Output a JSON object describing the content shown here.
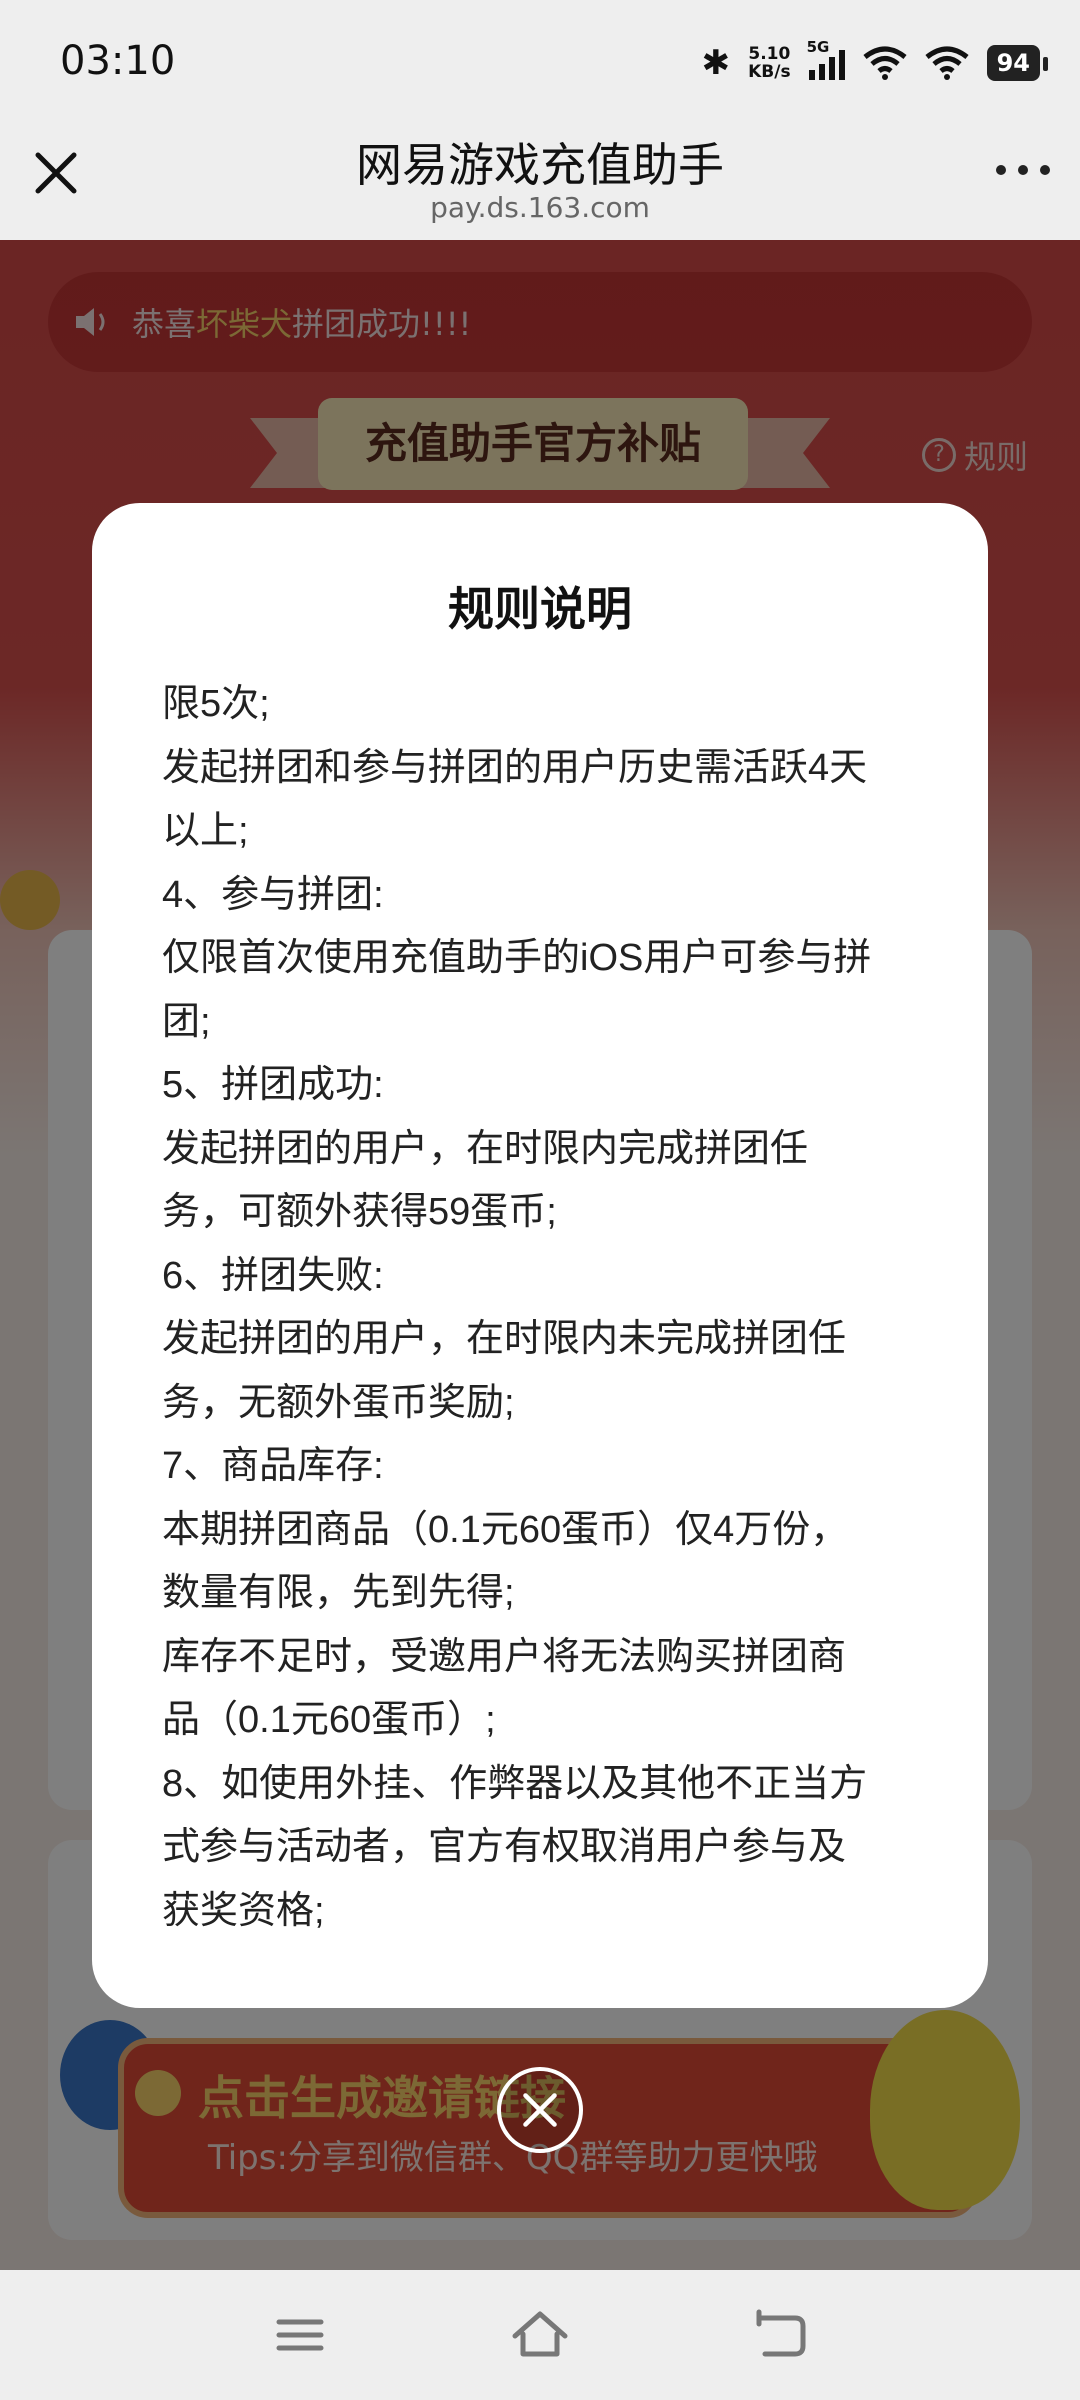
{
  "status_bar": {
    "time": "03:10",
    "speed_value": "5.10",
    "speed_unit": "KB/s",
    "network": "5G",
    "battery": "94"
  },
  "nav": {
    "title": "网易游戏充值助手",
    "url": "pay.ds.163.com"
  },
  "page": {
    "ticker_prefix": "恭喜",
    "ticker_name": "坏柴犬",
    "ticker_suffix": "拼团成功!!!!",
    "banner": "充值助手官方补贴",
    "rules_link": "规则",
    "cta_label": "点击生成邀请链接",
    "cta_tips": "Tips:分享到微信群、QQ群等助力更快哦"
  },
  "modal": {
    "title": "规则说明",
    "lines": [
      "限5次;",
      "发起拼团和参与拼团的用户历史需活跃4天",
      "以上;",
      "4、参与拼团:",
      "仅限首次使用充值助手的iOS用户可参与拼",
      "团;",
      "5、拼团成功:",
      "发起拼团的用户，在时限内完成拼团任",
      "务，可额外获得59蛋币;",
      "6、拼团失败:",
      "发起拼团的用户，在时限内未完成拼团任",
      "务，无额外蛋币奖励;",
      "7、商品库存:",
      "本期拼团商品（0.1元60蛋币）仅4万份，",
      "数量有限，先到先得;",
      "库存不足时，受邀用户将无法购买拼团商",
      "品（0.1元60蛋币）;",
      "8、如使用外挂、作弊器以及其他不正当方",
      "式参与活动者，官方有权取消用户参与及",
      "获奖资格;"
    ]
  },
  "colors": {
    "page_red": "#d64a48",
    "highlight_yellow": "#f7d36a",
    "cta_red": "#e04a36"
  },
  "icons": [
    "close-icon",
    "more-icon",
    "speaker-icon",
    "help-icon",
    "menu-icon",
    "home-icon",
    "back-icon",
    "bluetooth-icon",
    "signal-icon",
    "wifi-icon",
    "battery-icon"
  ]
}
